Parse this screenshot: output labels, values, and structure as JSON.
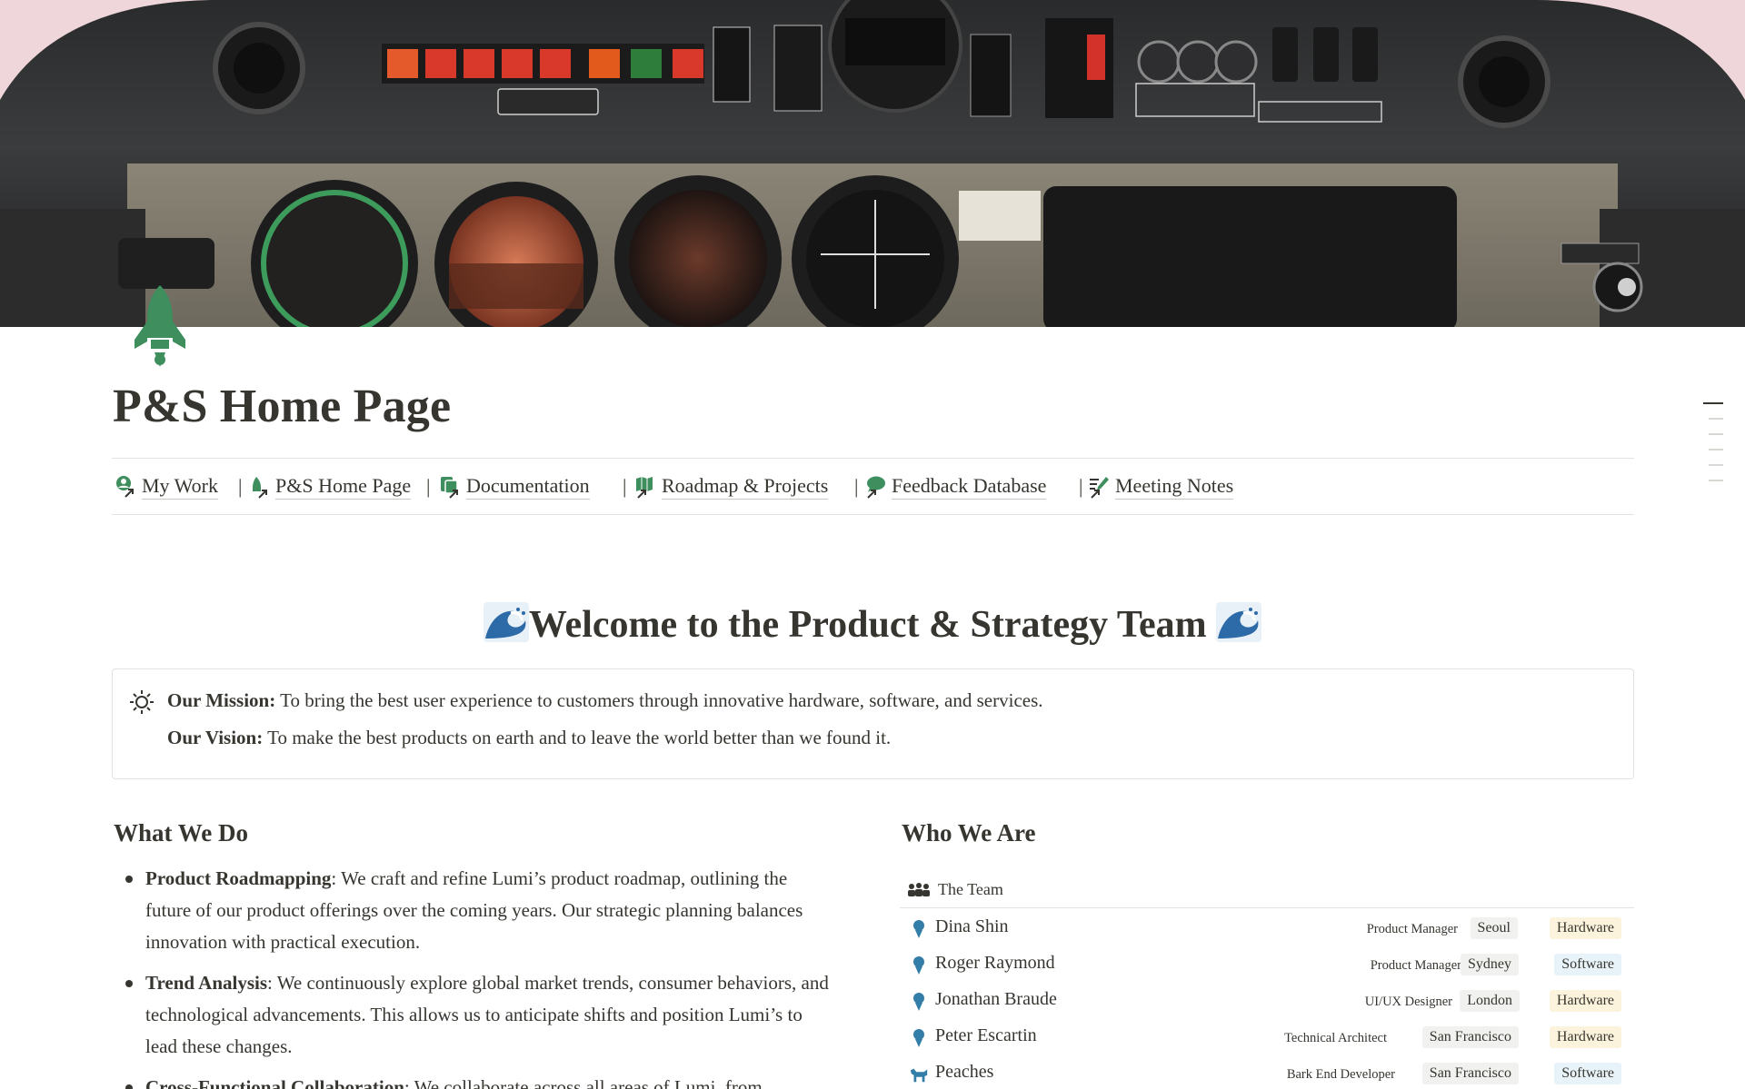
{
  "page": {
    "title": "P&S Home Page",
    "icon": "rocket-icon"
  },
  "nav": [
    {
      "label": "My Work",
      "icon": "person-link-icon"
    },
    {
      "label": "P&S Home Page",
      "icon": "rocket-link-icon"
    },
    {
      "label": "Documentation",
      "icon": "document-link-icon"
    },
    {
      "label": "Roadmap & Projects",
      "icon": "map-link-icon"
    },
    {
      "label": "Feedback Database",
      "icon": "chat-link-icon"
    },
    {
      "label": "Meeting Notes",
      "icon": "notes-link-icon"
    }
  ],
  "nav_separator": "|",
  "welcome": {
    "text": "Welcome to the Product & Strategy Team",
    "icon": "wave-icon"
  },
  "callout": {
    "icon": "sun-icon",
    "mission_label": "Our Mission:",
    "mission_text": " To bring the best user experience to customers through innovative hardware, software, and services.",
    "vision_label": "Our Vision:",
    "vision_text": " To make the best products on earth and to leave the world better than we found it."
  },
  "what_we_do": {
    "heading": "What We Do",
    "items": [
      {
        "title": "Product Roadmapping",
        "text": ": We craft and refine Lumi’s product roadmap, outlining the future of our product offerings over the coming years. Our strategic planning balances innovation with practical execution."
      },
      {
        "title": "Trend Analysis",
        "text": ": We continuously explore global market trends, consumer behaviors, and technological advancements. This allows us to anticipate shifts and position Lumi’s to lead these changes."
      },
      {
        "title": "Cross-Functional Collaboration",
        "text": ": We collaborate across all areas of Lumi, from"
      }
    ]
  },
  "who_we_are": {
    "heading": "Who We Are",
    "view_label": "The Team",
    "view_icon": "team-icon",
    "members": [
      {
        "name": "Dina Shin",
        "role": "Product Manager",
        "location": "Seoul",
        "area": "Hardware",
        "avatar": "person-icon"
      },
      {
        "name": "Roger Raymond",
        "role": "Product Manager",
        "location": "Sydney",
        "area": "Software",
        "avatar": "person-icon"
      },
      {
        "name": "Jonathan Braude",
        "role": "UI/UX Designer",
        "location": "London",
        "area": "Hardware",
        "avatar": "person-icon"
      },
      {
        "name": "Peter Escartin",
        "role": "Technical Architect",
        "location": "San Francisco",
        "area": "Hardware",
        "avatar": "person-icon"
      },
      {
        "name": "Peaches",
        "role": "Bark End Developer",
        "location": "San Francisco",
        "area": "Software",
        "avatar": "dog-icon"
      }
    ]
  },
  "colors": {
    "accent_green": "#3e8e5e",
    "avatar_blue": "#337ea9",
    "tag_location": "#f1f1ef",
    "tag_hardware": "#fbf3db",
    "tag_software": "#e7f3f8",
    "cover_pink": "#eed6da"
  }
}
